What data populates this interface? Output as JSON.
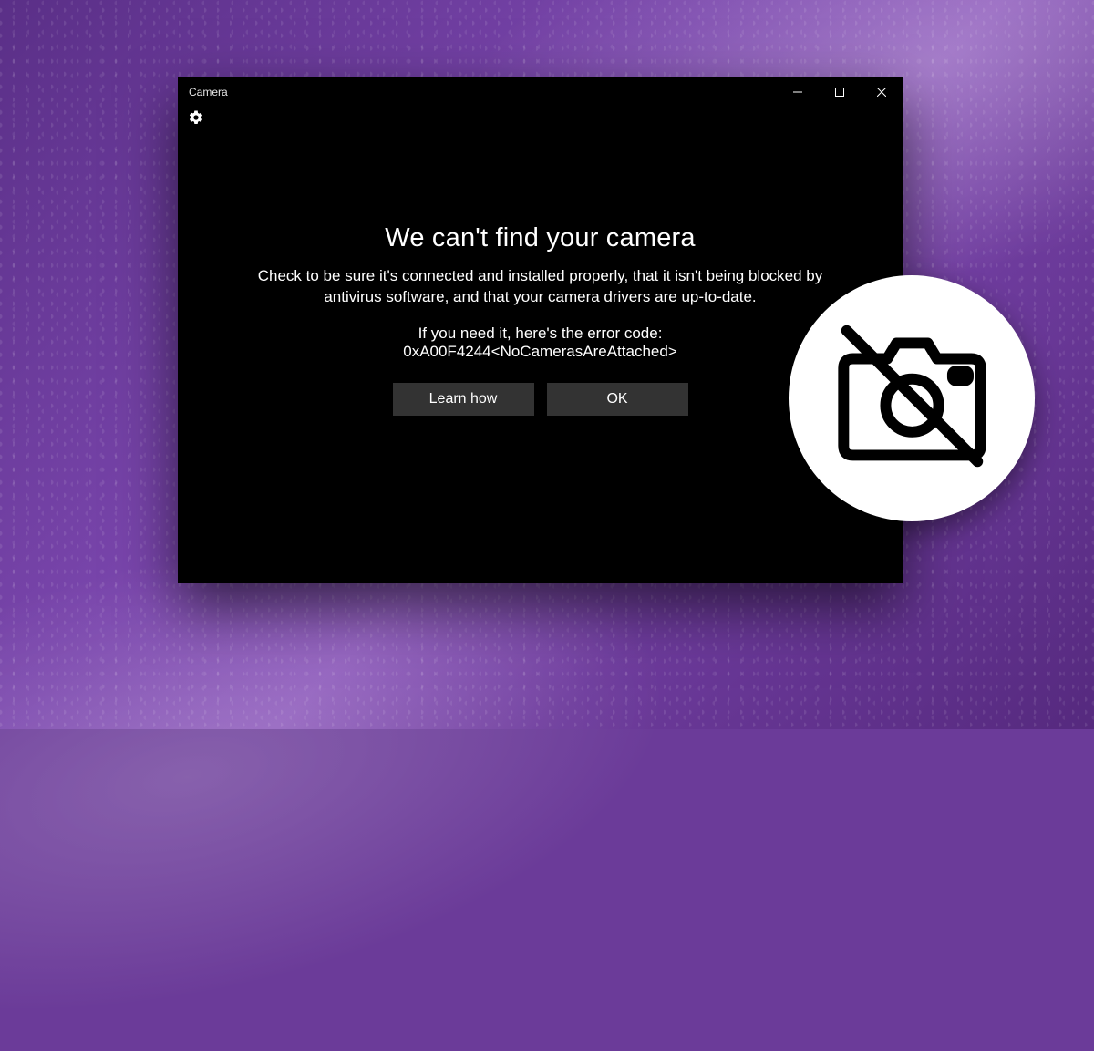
{
  "window": {
    "title": "Camera"
  },
  "message": {
    "heading": "We can't find your camera",
    "description": "Check to be sure it's connected and installed properly, that it isn't being blocked by antivirus software, and that your camera drivers are up-to-date.",
    "error_intro": "If you need it, here's the error code:",
    "error_code": "0xA00F4244<NoCamerasAreAttached>"
  },
  "buttons": {
    "learn_how": "Learn how",
    "ok": "OK"
  },
  "badge": {
    "icon_name": "no-camera-icon"
  }
}
